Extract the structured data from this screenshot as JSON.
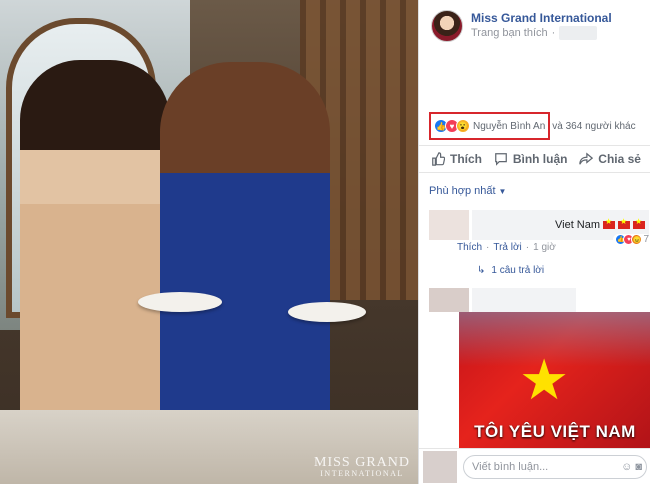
{
  "photo": {
    "watermark_line1": "MISS GRAND",
    "watermark_line2": "INTERNATIONAL"
  },
  "post": {
    "page_name": "Miss Grand International",
    "subtitle": "Trang bạn thích"
  },
  "reactions": {
    "icons": [
      "like-icon",
      "love-icon",
      "wow-icon"
    ],
    "highlighted_name": "Nguyễn Bình An",
    "rest": "và 364 người khác"
  },
  "actions": {
    "like": "Thích",
    "comment": "Bình luận",
    "share": "Chia sẻ"
  },
  "sort": {
    "label": "Phù hợp nhất"
  },
  "comments": [
    {
      "text": "Viet Nam",
      "reaction_count": "7",
      "like_link": "Thích",
      "reply_link": "Trả lời",
      "time": "1 giờ",
      "replies": "1 câu trả lời"
    },
    {
      "gif_text": "TÔI YÊU VIỆT NAM"
    }
  ],
  "composer": {
    "placeholder": "Viết bình luận..."
  },
  "colors": {
    "link_blue": "#365899",
    "highlight_box": "#d7262c",
    "flag_red": "#da251d"
  }
}
